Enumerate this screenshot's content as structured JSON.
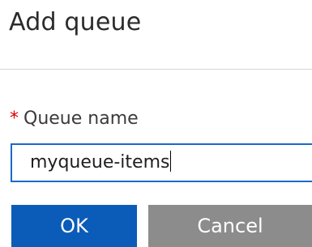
{
  "dialog": {
    "title": "Add queue"
  },
  "form": {
    "queue_name": {
      "required_marker": "*",
      "label": "Queue name",
      "value": "myqueue-items"
    }
  },
  "actions": {
    "ok_label": "OK",
    "cancel_label": "Cancel"
  },
  "colors": {
    "accent": "#0a5cb8",
    "required": "#e00000",
    "cancel": "#8c8c8c",
    "input_border": "#1b6ac9"
  }
}
